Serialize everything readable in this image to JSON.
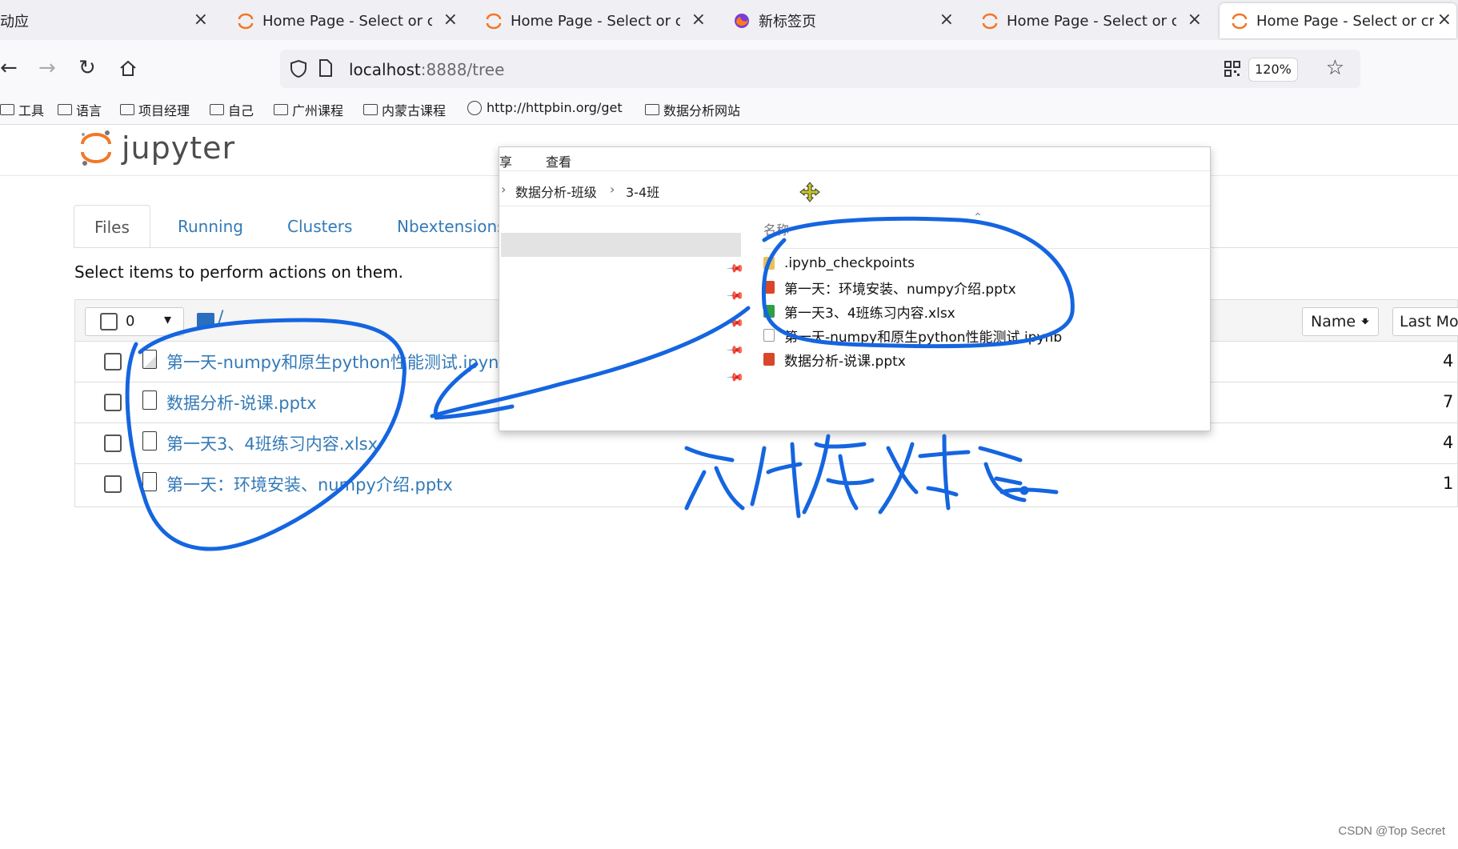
{
  "browser": {
    "tabs": [
      {
        "title": "动应",
        "favicon": "none"
      },
      {
        "title": "Home Page - Select or creat",
        "favicon": "jupyter-icon"
      },
      {
        "title": "Home Page - Select or creat",
        "favicon": "jupyter-icon"
      },
      {
        "title": "新标签页",
        "favicon": "firefox-icon"
      },
      {
        "title": "Home Page - Select or creat",
        "favicon": "jupyter-icon"
      },
      {
        "title": "Home Page - Select or creat",
        "favicon": "jupyter-icon",
        "active": true
      }
    ],
    "close_glyph": "×",
    "url_host": "localhost",
    "url_rest": ":8888/tree",
    "zoom": "120%",
    "bookmarks": [
      {
        "label": "工具",
        "kind": "folder"
      },
      {
        "label": "语言",
        "kind": "folder"
      },
      {
        "label": "项目经理",
        "kind": "folder"
      },
      {
        "label": "自己",
        "kind": "folder"
      },
      {
        "label": "广州课程",
        "kind": "folder"
      },
      {
        "label": "内蒙古课程",
        "kind": "folder"
      },
      {
        "label": "http://httpbin.org/get",
        "kind": "globe"
      },
      {
        "label": "数据分析网站",
        "kind": "folder"
      }
    ]
  },
  "jupyter": {
    "logo_text": "jupyter",
    "tabs": [
      "Files",
      "Running",
      "Clusters",
      "Nbextensions"
    ],
    "hint": "Select items to perform actions on them.",
    "selected_count": "0",
    "path": "/",
    "sort_name": "Name",
    "sort_modified": "Last Mo",
    "files": [
      {
        "name": "第一天-numpy和原生python性能测试.ipynb",
        "kind": "notebook",
        "date": "4"
      },
      {
        "name": "数据分析-说课.pptx",
        "kind": "file",
        "date": "7"
      },
      {
        "name": "第一天3、4班练习内容.xlsx",
        "kind": "file",
        "date": "4"
      },
      {
        "name": "第一天：环境安装、numpy介绍.pptx",
        "kind": "file",
        "date": "1"
      }
    ]
  },
  "explorer": {
    "menu": [
      "享",
      "查看"
    ],
    "crumbs": [
      "数据分析-班级",
      "3-4班"
    ],
    "column_header": "名称",
    "items": [
      {
        "name": ".ipynb_checkpoints",
        "color": "#e8c15a"
      },
      {
        "name": "第一天：环境安装、numpy介绍.pptx",
        "color": "#d9472b"
      },
      {
        "name": "第一天3、4班练习内容.xlsx",
        "color": "#2f9e44"
      },
      {
        "name": "第一天-numpy和原生python性能测试.ipynb",
        "color": "#ffffff"
      },
      {
        "name": "数据分析-说课.pptx",
        "color": "#d9472b"
      }
    ]
  },
  "watermark": "CSDN @Top Secret"
}
